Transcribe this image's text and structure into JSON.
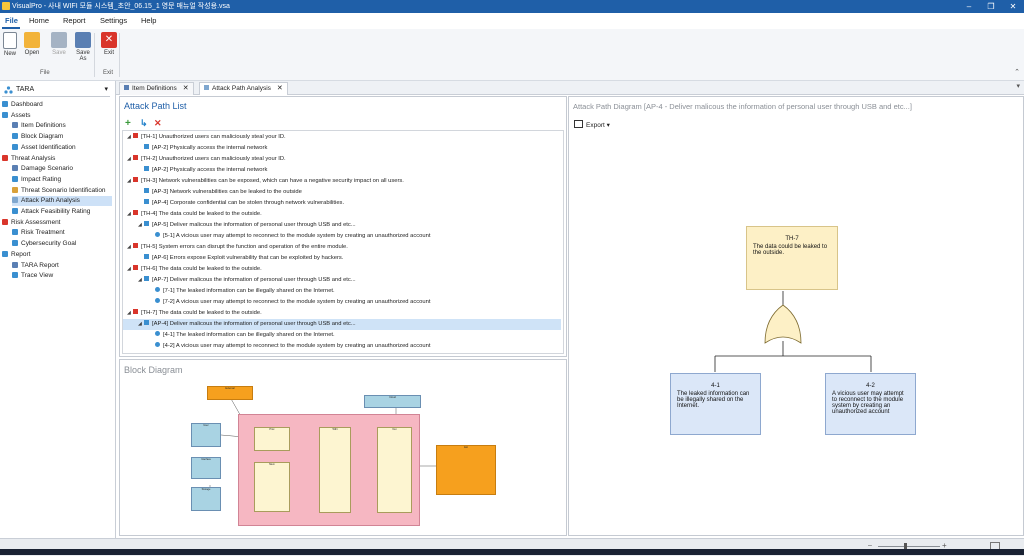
{
  "window": {
    "title": "VisualPro - 사내 WIFI 모듈 시스템_초안_06.15_1 영문 매뉴얼 작성용.vsa"
  },
  "menu": [
    "File",
    "Home",
    "Report",
    "Settings",
    "Help"
  ],
  "ribbon": {
    "buttons": [
      {
        "label": "New"
      },
      {
        "label": "Open"
      },
      {
        "label": "Save"
      },
      {
        "label": "Save\nAs"
      },
      {
        "label": "Exit"
      }
    ],
    "groups": {
      "file": "File",
      "exit": "Exit"
    }
  },
  "project_selector": {
    "value": "TARA"
  },
  "tree": [
    {
      "label": "Dashboard"
    },
    {
      "label": "Assets"
    },
    {
      "label": "Item Definitions"
    },
    {
      "label": "Block Diagram"
    },
    {
      "label": "Asset Identification"
    },
    {
      "label": "Threat Analysis"
    },
    {
      "label": "Damage Scenario"
    },
    {
      "label": "Impact Rating"
    },
    {
      "label": "Threat Scenario Identification"
    },
    {
      "label": "Attack Path Analysis"
    },
    {
      "label": "Attack Feasibility Rating"
    },
    {
      "label": "Risk Assessment"
    },
    {
      "label": "Risk Treatment"
    },
    {
      "label": "Cybersecurity Goal"
    },
    {
      "label": "Report"
    },
    {
      "label": "TARA Report"
    },
    {
      "label": "Trace View"
    }
  ],
  "tabs": [
    {
      "label": "Item Definitions"
    },
    {
      "label": "Attack Path Analysis"
    }
  ],
  "attack_path_list": {
    "title": "Attack Path List",
    "rows": [
      {
        "text": "[TH-1] Unauthorized users can maliciously steal your ID."
      },
      {
        "text": "[AP-2] Physically access the internal network"
      },
      {
        "text": "[TH-2] Unauthorized users can maliciously steal your ID."
      },
      {
        "text": "[AP-2] Physically access the internal network"
      },
      {
        "text": "[TH-3] Network vulnerabilities can be exposed, which can have a negative security impact on all users."
      },
      {
        "text": "[AP-3] Network vulnerabilities can be leaked to the outside"
      },
      {
        "text": "[AP-4] Corporate confidential can be stolen through network vulnerabilities."
      },
      {
        "text": "[TH-4] The data could be leaked to the outside."
      },
      {
        "text": "[AP-5] Deliver malicous the information of personal user through USB and etc..."
      },
      {
        "text": "[5-1] A vicious user may attempt to reconnect to the module system by creating an unauthorized account"
      },
      {
        "text": "[TH-5] System errors can disrupt the function and operation of the entire module."
      },
      {
        "text": "[AP-6] Errors expose Exploit vulnerability that can be exploited by hackers."
      },
      {
        "text": "[TH-6] The data could be leaked to the outside."
      },
      {
        "text": "[AP-7] Deliver malicous the information of personal user through USB and etc..."
      },
      {
        "text": "[7-1] The leaked information can be illegally shared on the Internet."
      },
      {
        "text": "[7-2] A vicious user may attempt to reconnect to the module system by creating an unauthorized account"
      },
      {
        "text": "[TH-7] The data could be leaked to the outside."
      },
      {
        "text": "[AP-4] Deliver malicous the information of personal user through USB and etc..."
      },
      {
        "text": "[4-1] The leaked information can be illegally shared on the Internet."
      },
      {
        "text": "[4-2] A vicious user may attempt to reconnect to the module system by creating an unauthorized account"
      }
    ]
  },
  "block_diagram": {
    "title": "Block Diagram"
  },
  "attack_path_diagram": {
    "title": "Attack Path Diagram [AP-4 - Deliver malicous the information of personal user through USB and etc...]",
    "export_label": "Export",
    "top": {
      "id": "TH-7",
      "text": "The data could be leaked to the outside."
    },
    "children": [
      {
        "id": "4-1",
        "text": "The leaked information can be illegally shared on the Internet."
      },
      {
        "id": "4-2",
        "text": "A vicious user may attempt to reconnect to the module system by creating an unauthorized account"
      }
    ]
  },
  "colors": {
    "accent": "#1f5fa8",
    "threat": "#d9352b",
    "path": "#3a8fd0",
    "leaf": "#3a8fd0",
    "top_box": "#fdf0c6",
    "child_box": "#dbe7f8",
    "selected": "#cfe3f7"
  }
}
